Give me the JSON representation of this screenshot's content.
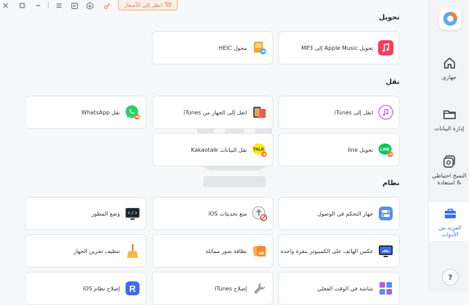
{
  "topbar": {
    "pricing_label": "انظر إلى الأسعار",
    "icons": [
      "close-icon",
      "maximize-icon",
      "minimize-icon",
      "menu-icon",
      "feedback-icon",
      "download-icon",
      "key-icon"
    ]
  },
  "sidebar": {
    "items": [
      {
        "label": "جهازي",
        "icon": "home-icon"
      },
      {
        "label": "إدارة البيانات",
        "icon": "folder-icon"
      },
      {
        "label": "النسخ احتياطي & استعادة",
        "icon": "backup-icon"
      },
      {
        "label": "المزيد من الأدوات",
        "icon": "toolbox-icon"
      }
    ],
    "help_label": "?"
  },
  "sections": {
    "convert": {
      "title": "تحويل",
      "cards": [
        {
          "label": "تحويل Apple Music إلى MP3",
          "icon": "apple-music-icon"
        },
        {
          "label": "محول HEIC",
          "icon": "heic-icon"
        }
      ]
    },
    "transfer": {
      "title": "نقل",
      "cards": [
        {
          "label": "انقل إلى iTunes",
          "icon": "itunes-icon"
        },
        {
          "label": "انقل إلى الجهاز من iTunes",
          "icon": "itunes-device-icon"
        },
        {
          "label": "نقل WhatsApp",
          "icon": "whatsapp-icon"
        },
        {
          "label": "تحويل line",
          "icon": "line-icon"
        },
        {
          "label": "نقل البيانات Kakaotalk",
          "icon": "kakaotalk-icon"
        }
      ]
    },
    "system": {
      "title": "نظام",
      "cards": [
        {
          "label": "جهاز التحكم في الوصول",
          "icon": "access-control-icon"
        },
        {
          "label": "منع تحديثات iOS",
          "icon": "block-update-icon"
        },
        {
          "label": "وضع المطور",
          "icon": "developer-mode-icon"
        },
        {
          "label": "عكس الهاتف على الكمبيوتر بنقرة واحدة",
          "icon": "screen-mirror-icon"
        },
        {
          "label": "نظافة صور مماثلة",
          "icon": "similar-photos-icon"
        },
        {
          "label": "تنظيف تخزين الجهاز",
          "icon": "broom-icon"
        },
        {
          "label": "شاشة في الوقت الفعلي",
          "icon": "realtime-screen-icon"
        },
        {
          "label": "إصلاح iTunes",
          "icon": "wrench-icon"
        },
        {
          "label": "إصلاح نظام iOS",
          "icon": "ios-repair-icon"
        }
      ]
    }
  },
  "colors": {
    "accent": "#3b6cf6",
    "pricing_orange": "#ee7a3c",
    "music_red": "#fa3b57",
    "whatsapp_green": "#25d366",
    "line_green": "#06c755",
    "kakao_yellow": "#ffe812"
  }
}
